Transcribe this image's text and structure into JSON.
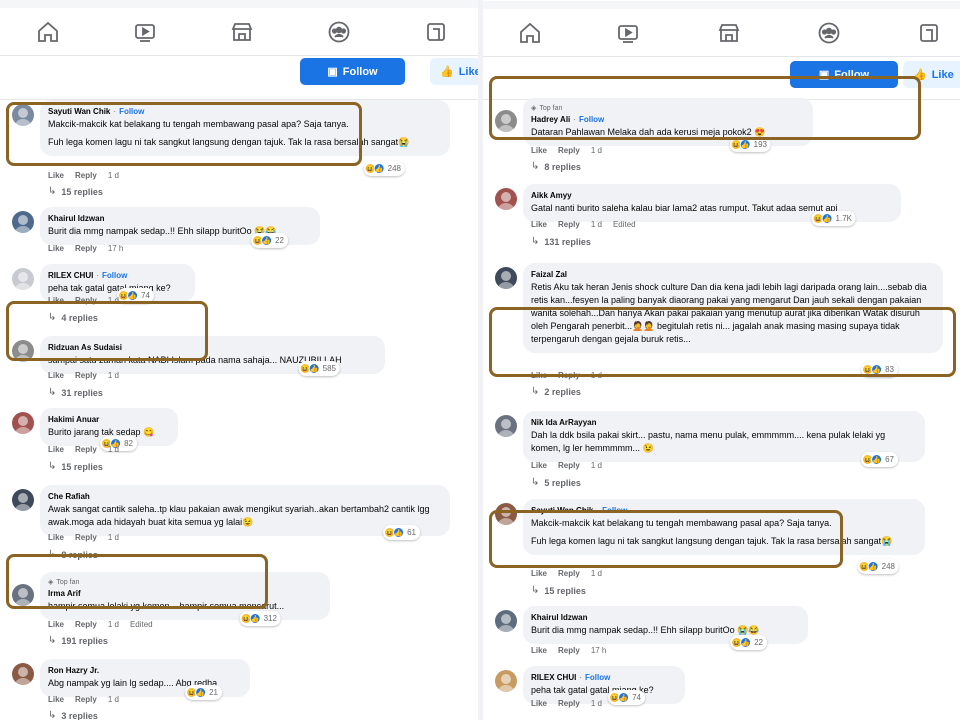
{
  "nav_icons": [
    "home-icon",
    "video-icon",
    "marketplace-icon",
    "groups-icon",
    "feeds-icon"
  ],
  "actions": {
    "follow_label": "Follow",
    "like_label": "Like"
  },
  "colors": {
    "accent": "#1b74e4",
    "highlight": "#8b6424",
    "bubble": "#f0f2f5"
  },
  "meta_labels": {
    "like": "Like",
    "reply": "Reply"
  },
  "left_comments": [
    {
      "author": "Sayuti Wan Chik",
      "follow": "Follow",
      "texts": [
        "Makcik-makcik kat belakang tu tengah membawang pasal apa? Saja tanya.",
        "Fuh lega komen lagu ni tak sangkut langsung dengan tajuk. Tak la rasa bersalah sangat😭"
      ],
      "reaction_count": "248",
      "time": "1 d",
      "replies": "15 replies"
    },
    {
      "author": "Khairul Idzwan",
      "texts": [
        "Burit dia mmg nampak sedap..!! Ehh silapp buritOo 😭😂"
      ],
      "reaction_count": "22",
      "time": "17 h"
    },
    {
      "author": "RILEX CHUI",
      "follow": "Follow",
      "texts": [
        "peha tak gatal gatal miang ke?"
      ],
      "reaction_count": "74",
      "time": "1 d",
      "replies": "4 replies"
    },
    {
      "author": "Ridzuan As Sudaisi",
      "texts": [
        "sampai satu zaman kata NABI Islam pada nama sahaja... NAUZUBILLAH"
      ],
      "reaction_count": "585",
      "time": "1 d",
      "replies": "31 replies"
    },
    {
      "author": "Hakimi Anuar",
      "texts": [
        "Burito jarang tak sedap 😋"
      ],
      "reaction_count": "82",
      "time": "1 d",
      "replies": "15 replies"
    },
    {
      "author": "Che Rafiah",
      "texts": [
        "Awak sangat cantik saleha..tp klau pakaian awak mengikut syariah..akan bertambah2 cantik lgg awak.moga ada hidayah buat kita semua yg lalai😉"
      ],
      "reaction_count": "61",
      "time": "1 d",
      "replies": "8 replies"
    },
    {
      "topfan": "Top fan",
      "author": "Irma Arif",
      "texts": [
        "hampir semua lelaki yg komen ...hampir semua mencarut..."
      ],
      "reaction_count": "312",
      "time": "1 d",
      "edited": "Edited",
      "replies": "191 replies"
    },
    {
      "author": "Ron Hazry Jr.",
      "texts": [
        "Abg nampak yg lain lg sedap.... Abg redha"
      ],
      "reaction_count": "21",
      "time": "1 d",
      "replies": "3 replies"
    }
  ],
  "right_comments": [
    {
      "topfan": "Top fan",
      "author": "Hadrey Ali",
      "follow": "Follow",
      "texts": [
        "Dataran Pahlawan Melaka dah ada kerusi meja pokok2 😍"
      ],
      "reaction_count": "193",
      "time": "1 d",
      "replies": "8 replies"
    },
    {
      "author": "Aikk Amyy",
      "texts": [
        "Gatal nanti burito saleha kalau biar lama2 atas rumput. Takut adaa semut api"
      ],
      "reaction_count": "1.7K",
      "time": "1 d",
      "edited": "Edited",
      "replies": "131 replies"
    },
    {
      "author": "Faizal Zal",
      "texts": [
        "Retis Aku tak heran Jenis shock culture Dan dia kena jadi lebih lagi daripada orang lain....sebab dia retis kan...fesyen la paling banyak diaorang pakai yang mengarut Dan jauh sekali dengan pakaian wanita solehah...Dan hanya Akan pakai pakaian yang menutup aurat jika diberikan Watak disuruh oleh Pengarah penerbit...🤦🤦 begitulah retis ni... jagalah anak masing masing supaya tidak terpengaruh dengan gejala buruk retis..."
      ],
      "reaction_count": "83",
      "time": "1 d",
      "replies": "2 replies"
    },
    {
      "author": "Nik Ida ArRayyan",
      "texts": [
        "Dah la ddk bsila pakai skirt... pastu, nama menu pulak, emmmmm.... kena pulak lelaki yg komen, lg ler hemmmmm... 😉"
      ],
      "reaction_count": "67",
      "time": "1 d",
      "replies": "5 replies"
    },
    {
      "author": "Sayuti Wan Chik",
      "follow": "Follow",
      "texts": [
        "Makcik-makcik kat belakang tu tengah membawang pasal apa? Saja tanya.",
        "Fuh lega komen lagu ni tak sangkut langsung dengan tajuk. Tak la rasa bersalah sangat😭"
      ],
      "reaction_count": "248",
      "time": "1 d",
      "replies": "15 replies"
    },
    {
      "author": "Khairul Idzwan",
      "texts": [
        "Burit dia mmg nampak sedap..!! Ehh silapp buritOo 😭😂"
      ],
      "reaction_count": "22",
      "time": "17 h"
    },
    {
      "author": "RILEX CHUI",
      "follow": "Follow",
      "texts": [
        "peha tak gatal gatal miang ke?"
      ],
      "reaction_count": "74",
      "time": "1 d"
    }
  ]
}
